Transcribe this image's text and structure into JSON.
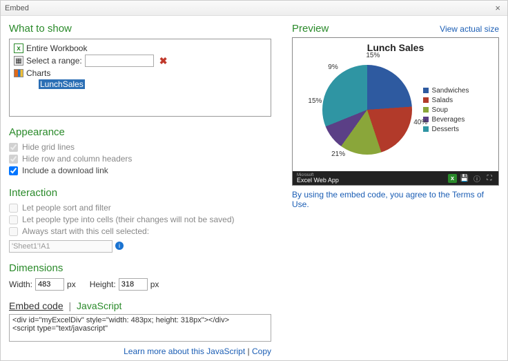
{
  "window": {
    "title": "Embed"
  },
  "whatToShow": {
    "heading": "What to show",
    "entireWorkbook": "Entire Workbook",
    "selectRange": "Select a range:",
    "charts": "Charts",
    "chartItems": [
      "LunchSales"
    ]
  },
  "appearance": {
    "heading": "Appearance",
    "hideGrid": "Hide grid lines",
    "hideHeaders": "Hide row and column headers",
    "download": "Include a download link"
  },
  "interaction": {
    "heading": "Interaction",
    "sortFilter": "Let people sort and filter",
    "typeCells": "Let people type into cells (their changes will not be saved)",
    "startCell": "Always start with this cell selected:",
    "cellRef": "'Sheet1'!A1"
  },
  "dimensions": {
    "heading": "Dimensions",
    "widthLabel": "Width:",
    "widthVal": "483",
    "heightLabel": "Height:",
    "heightVal": "318",
    "px": "px"
  },
  "embed": {
    "tabEmbed": "Embed code",
    "tabJs": "JavaScript",
    "code": "<div id=\"myExcelDiv\" style=\"width: 483px; height: 318px\"></div>\n<script type=\"text/javascript\"",
    "learnMore": "Learn more about this JavaScript",
    "copy": "Copy"
  },
  "preview": {
    "heading": "Preview",
    "viewActual": "View actual size",
    "appName": "Excel Web App",
    "appVendor": "Microsoft",
    "terms": "By using the embed code, you agree to the Terms of Use."
  },
  "chart_data": {
    "type": "pie",
    "title": "Lunch Sales",
    "series": [
      {
        "name": "Sandwiches",
        "value": 40,
        "color": "#2e5aa0"
      },
      {
        "name": "Salads",
        "value": 21,
        "color": "#b23a2a"
      },
      {
        "name": "Soup",
        "value": 15,
        "color": "#8aa63a"
      },
      {
        "name": "Beverages",
        "value": 9,
        "color": "#5b3f86"
      },
      {
        "name": "Desserts",
        "value": 15,
        "color": "#2f95a3"
      }
    ]
  }
}
